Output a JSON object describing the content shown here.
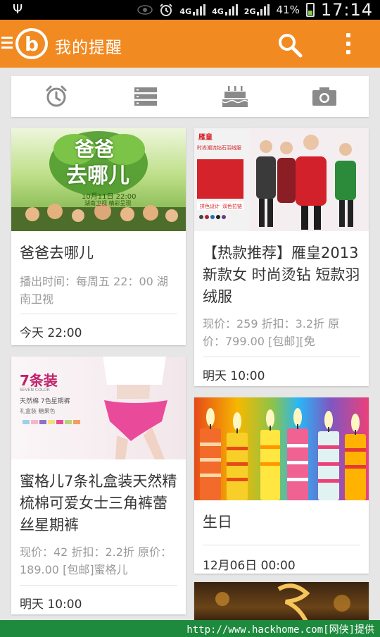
{
  "status_bar": {
    "usb_symbol": "Ψ",
    "network_1": "4G",
    "network_2": "4G",
    "network_3": "2G",
    "battery": "41%",
    "time": "17:14"
  },
  "app_bar": {
    "logo_letter": "b",
    "title": "我的提醒"
  },
  "tabs": [
    "alarm-clock",
    "list",
    "birthday-cake",
    "camera"
  ],
  "cards": [
    {
      "title": "爸爸去哪儿",
      "description": "播出时间：每周五 22：00 湖南卫视",
      "time": "今天 22:00",
      "image_text": [
        "爸爸",
        "去哪儿",
        "10月11日 22:00",
        "湖南卫视 精彩呈现"
      ]
    },
    {
      "title": "【热款推荐】雁皇2013新款女 时尚烫钻 短款羽绒服",
      "description": "现价：259 折扣：3.2折 原价：799.00 [包邮][免",
      "time": "明天 10:00",
      "image_text": [
        "雁皇",
        "时尚潮流钻石羽绒服",
        "拼色设计",
        "双色拉链"
      ]
    },
    {
      "title": "蜜格儿7条礼盒装天然精梳棉可爱女士三角裤蕾丝星期裤",
      "description": "现价：42 折扣：2.2折 原价：189.00 [包邮]蜜格儿",
      "time": "明天 10:00",
      "image_text": [
        "7条装",
        "SEVEN COLOR",
        "天然棉 7色星期裤",
        "礼盒装 糖果色"
      ]
    },
    {
      "title": "生日",
      "description": "",
      "time": "12月06日 00:00",
      "image_text": []
    }
  ],
  "watermark": "http://www.hackhome.com[网侠]提供",
  "colors": {
    "accent": "#f28a22",
    "background": "#e6e6e6",
    "watermark_bg": "#1e8a3e"
  }
}
